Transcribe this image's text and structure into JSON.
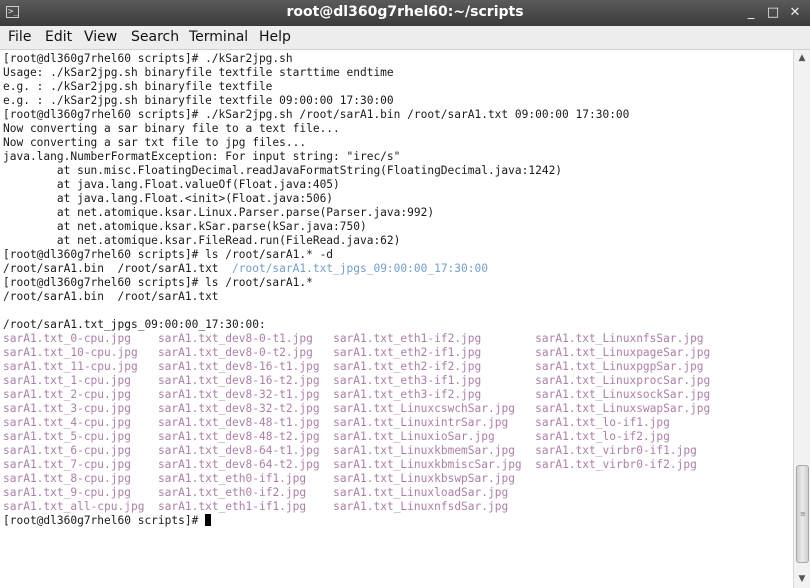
{
  "window": {
    "title": "root@dl360g7rhel60:~/scripts",
    "controls": {
      "minimize": "_",
      "maximize": "□",
      "close": "✕"
    }
  },
  "menu": [
    "File",
    "Edit",
    "View",
    "Search",
    "Terminal",
    "Help"
  ],
  "terminal": {
    "lines": [
      [
        {
          "t": "[root@dl360g7rhel60 scripts]# ./kSar2jpg.sh",
          "c": ""
        }
      ],
      [
        {
          "t": "Usage: ./kSar2jpg.sh binaryfile textfile starttime endtime",
          "c": ""
        }
      ],
      [
        {
          "t": "e.g. : ./kSar2jpg.sh binaryfile textfile",
          "c": ""
        }
      ],
      [
        {
          "t": "e.g. : ./kSar2jpg.sh binaryfile textfile 09:00:00 17:30:00",
          "c": ""
        }
      ],
      [
        {
          "t": "[root@dl360g7rhel60 scripts]# ./kSar2jpg.sh /root/sarA1.bin /root/sarA1.txt 09:00:00 17:30:00",
          "c": ""
        }
      ],
      [
        {
          "t": "Now converting a sar binary file to a text file...",
          "c": ""
        }
      ],
      [
        {
          "t": "Now converting a sar txt file to jpg files...",
          "c": ""
        }
      ],
      [
        {
          "t": "java.lang.NumberFormatException: For input string: \"irec/s\"",
          "c": ""
        }
      ],
      [
        {
          "t": "        at sun.misc.FloatingDecimal.readJavaFormatString(FloatingDecimal.java:1242)",
          "c": ""
        }
      ],
      [
        {
          "t": "        at java.lang.Float.valueOf(Float.java:405)",
          "c": ""
        }
      ],
      [
        {
          "t": "        at java.lang.Float.<init>(Float.java:506)",
          "c": ""
        }
      ],
      [
        {
          "t": "        at net.atomique.ksar.Linux.Parser.parse(Parser.java:992)",
          "c": ""
        }
      ],
      [
        {
          "t": "        at net.atomique.ksar.kSar.parse(kSar.java:750)",
          "c": ""
        }
      ],
      [
        {
          "t": "        at net.atomique.ksar.FileRead.run(FileRead.java:62)",
          "c": ""
        }
      ],
      [
        {
          "t": "[root@dl360g7rhel60 scripts]# ls /root/sarA1.* -d",
          "c": ""
        }
      ],
      [
        {
          "t": "/root/sarA1.bin  /root/sarA1.txt  ",
          "c": ""
        },
        {
          "t": "/root/sarA1.txt_jpgs_09:00:00_17:30:00",
          "c": "dir"
        }
      ],
      [
        {
          "t": "[root@dl360g7rhel60 scripts]# ls /root/sarA1.*",
          "c": ""
        }
      ],
      [
        {
          "t": "/root/sarA1.bin  /root/sarA1.txt",
          "c": ""
        }
      ],
      [
        {
          "t": "",
          "c": ""
        }
      ],
      [
        {
          "t": "/root/sarA1.txt_jpgs_09:00:00_17:30:00:",
          "c": ""
        }
      ],
      [
        {
          "t": "sarA1.txt_0-cpu.jpg",
          "c": "jpg"
        },
        {
          "t": "    ",
          "c": ""
        },
        {
          "t": "sarA1.txt_dev8-0-t1.jpg",
          "c": "jpg"
        },
        {
          "t": "   ",
          "c": ""
        },
        {
          "t": "sarA1.txt_eth1-if2.jpg",
          "c": "jpg"
        },
        {
          "t": "        ",
          "c": ""
        },
        {
          "t": "sarA1.txt_LinuxnfsSar.jpg",
          "c": "jpg"
        }
      ],
      [
        {
          "t": "sarA1.txt_10-cpu.jpg",
          "c": "jpg"
        },
        {
          "t": "   ",
          "c": ""
        },
        {
          "t": "sarA1.txt_dev8-0-t2.jpg",
          "c": "jpg"
        },
        {
          "t": "   ",
          "c": ""
        },
        {
          "t": "sarA1.txt_eth2-if1.jpg",
          "c": "jpg"
        },
        {
          "t": "        ",
          "c": ""
        },
        {
          "t": "sarA1.txt_LinuxpageSar.jpg",
          "c": "jpg"
        }
      ],
      [
        {
          "t": "sarA1.txt_11-cpu.jpg",
          "c": "jpg"
        },
        {
          "t": "   ",
          "c": ""
        },
        {
          "t": "sarA1.txt_dev8-16-t1.jpg",
          "c": "jpg"
        },
        {
          "t": "  ",
          "c": ""
        },
        {
          "t": "sarA1.txt_eth2-if2.jpg",
          "c": "jpg"
        },
        {
          "t": "        ",
          "c": ""
        },
        {
          "t": "sarA1.txt_LinuxpgpSar.jpg",
          "c": "jpg"
        }
      ],
      [
        {
          "t": "sarA1.txt_1-cpu.jpg",
          "c": "jpg"
        },
        {
          "t": "    ",
          "c": ""
        },
        {
          "t": "sarA1.txt_dev8-16-t2.jpg",
          "c": "jpg"
        },
        {
          "t": "  ",
          "c": ""
        },
        {
          "t": "sarA1.txt_eth3-if1.jpg",
          "c": "jpg"
        },
        {
          "t": "        ",
          "c": ""
        },
        {
          "t": "sarA1.txt_LinuxprocSar.jpg",
          "c": "jpg"
        }
      ],
      [
        {
          "t": "sarA1.txt_2-cpu.jpg",
          "c": "jpg"
        },
        {
          "t": "    ",
          "c": ""
        },
        {
          "t": "sarA1.txt_dev8-32-t1.jpg",
          "c": "jpg"
        },
        {
          "t": "  ",
          "c": ""
        },
        {
          "t": "sarA1.txt_eth3-if2.jpg",
          "c": "jpg"
        },
        {
          "t": "        ",
          "c": ""
        },
        {
          "t": "sarA1.txt_LinuxsockSar.jpg",
          "c": "jpg"
        }
      ],
      [
        {
          "t": "sarA1.txt_3-cpu.jpg",
          "c": "jpg"
        },
        {
          "t": "    ",
          "c": ""
        },
        {
          "t": "sarA1.txt_dev8-32-t2.jpg",
          "c": "jpg"
        },
        {
          "t": "  ",
          "c": ""
        },
        {
          "t": "sarA1.txt_LinuxcswchSar.jpg",
          "c": "jpg"
        },
        {
          "t": "   ",
          "c": ""
        },
        {
          "t": "sarA1.txt_LinuxswapSar.jpg",
          "c": "jpg"
        }
      ],
      [
        {
          "t": "sarA1.txt_4-cpu.jpg",
          "c": "jpg"
        },
        {
          "t": "    ",
          "c": ""
        },
        {
          "t": "sarA1.txt_dev8-48-t1.jpg",
          "c": "jpg"
        },
        {
          "t": "  ",
          "c": ""
        },
        {
          "t": "sarA1.txt_LinuxintrSar.jpg",
          "c": "jpg"
        },
        {
          "t": "    ",
          "c": ""
        },
        {
          "t": "sarA1.txt_lo-if1.jpg",
          "c": "jpg"
        }
      ],
      [
        {
          "t": "sarA1.txt_5-cpu.jpg",
          "c": "jpg"
        },
        {
          "t": "    ",
          "c": ""
        },
        {
          "t": "sarA1.txt_dev8-48-t2.jpg",
          "c": "jpg"
        },
        {
          "t": "  ",
          "c": ""
        },
        {
          "t": "sarA1.txt_LinuxioSar.jpg",
          "c": "jpg"
        },
        {
          "t": "      ",
          "c": ""
        },
        {
          "t": "sarA1.txt_lo-if2.jpg",
          "c": "jpg"
        }
      ],
      [
        {
          "t": "sarA1.txt_6-cpu.jpg",
          "c": "jpg"
        },
        {
          "t": "    ",
          "c": ""
        },
        {
          "t": "sarA1.txt_dev8-64-t1.jpg",
          "c": "jpg"
        },
        {
          "t": "  ",
          "c": ""
        },
        {
          "t": "sarA1.txt_LinuxkbmemSar.jpg",
          "c": "jpg"
        },
        {
          "t": "   ",
          "c": ""
        },
        {
          "t": "sarA1.txt_virbr0-if1.jpg",
          "c": "jpg"
        }
      ],
      [
        {
          "t": "sarA1.txt_7-cpu.jpg",
          "c": "jpg"
        },
        {
          "t": "    ",
          "c": ""
        },
        {
          "t": "sarA1.txt_dev8-64-t2.jpg",
          "c": "jpg"
        },
        {
          "t": "  ",
          "c": ""
        },
        {
          "t": "sarA1.txt_LinuxkbmiscSar.jpg",
          "c": "jpg"
        },
        {
          "t": "  ",
          "c": ""
        },
        {
          "t": "sarA1.txt_virbr0-if2.jpg",
          "c": "jpg"
        }
      ],
      [
        {
          "t": "sarA1.txt_8-cpu.jpg",
          "c": "jpg"
        },
        {
          "t": "    ",
          "c": ""
        },
        {
          "t": "sarA1.txt_eth0-if1.jpg",
          "c": "jpg"
        },
        {
          "t": "    ",
          "c": ""
        },
        {
          "t": "sarA1.txt_LinuxkbswpSar.jpg",
          "c": "jpg"
        }
      ],
      [
        {
          "t": "sarA1.txt_9-cpu.jpg",
          "c": "jpg"
        },
        {
          "t": "    ",
          "c": ""
        },
        {
          "t": "sarA1.txt_eth0-if2.jpg",
          "c": "jpg"
        },
        {
          "t": "    ",
          "c": ""
        },
        {
          "t": "sarA1.txt_LinuxloadSar.jpg",
          "c": "jpg"
        }
      ],
      [
        {
          "t": "sarA1.txt_all-cpu.jpg",
          "c": "jpg"
        },
        {
          "t": "  ",
          "c": ""
        },
        {
          "t": "sarA1.txt_eth1-if1.jpg",
          "c": "jpg"
        },
        {
          "t": "    ",
          "c": ""
        },
        {
          "t": "sarA1.txt_LinuxnfsdSar.jpg",
          "c": "jpg"
        }
      ]
    ],
    "prompt": "[root@dl360g7rhel60 scripts]# ",
    "colors": {
      "jpg": "#ad7fa8",
      "dir": "#729fcf",
      "text": "#1a1a1a"
    }
  }
}
